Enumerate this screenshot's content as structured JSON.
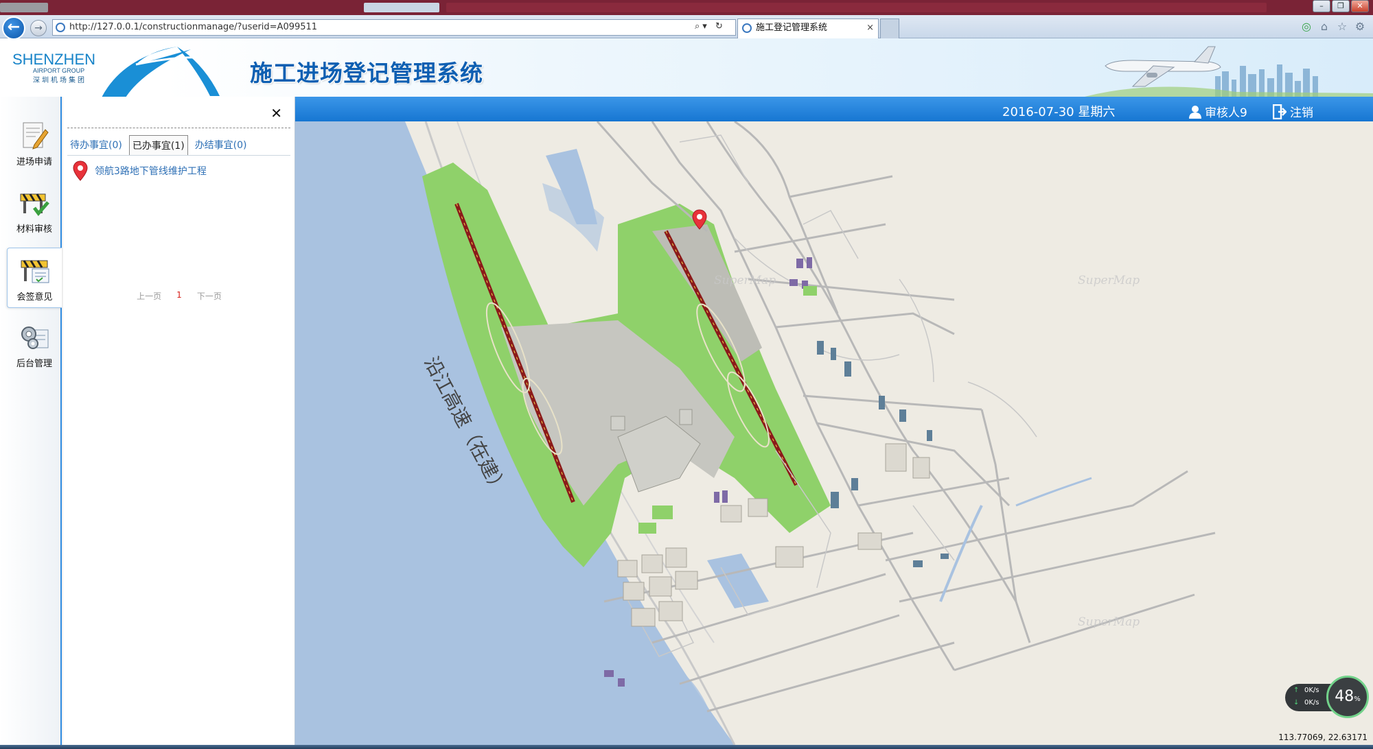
{
  "browser": {
    "url": "http://127.0.0.1/constructionmanage/?userid=A099511",
    "url_tools": "⌕▾ ↻",
    "tab_title": "施工登记管理系统",
    "tab_close": "×"
  },
  "header": {
    "logo_en": "SHENZHEN",
    "logo_sub": "AIRPORT GROUP",
    "logo_cn": "深圳机场集团",
    "title": "施工进场登记管理系统"
  },
  "sidebar": {
    "items": [
      {
        "label": "进场申请",
        "icon": "form-edit-icon"
      },
      {
        "label": "材料审核",
        "icon": "barrier-check-icon"
      },
      {
        "label": "会签意见",
        "icon": "barrier-document-icon"
      },
      {
        "label": "后台管理",
        "icon": "gears-settings-icon"
      }
    ],
    "active_index": 2
  },
  "task_panel": {
    "close_glyph": "✕",
    "tabs": [
      {
        "label": "待办事宜(0)"
      },
      {
        "label": "已办事宜(1)"
      },
      {
        "label": "办结事宜(0)"
      }
    ],
    "active_tab": 1,
    "items": [
      {
        "title": "领航3路地下管线维护工程"
      }
    ],
    "pager": {
      "prev": "上一页",
      "current": "1",
      "next": "下一页"
    }
  },
  "topbar": {
    "date": "2016-07-30 星期六",
    "user": "审核人9",
    "logout": "注销"
  },
  "map": {
    "road_label": "沿江高速（在建）",
    "watermark": "SuperMap",
    "coordinates": "113.77069, 22.63171",
    "net": {
      "up": "0K/s",
      "down": "0K/s",
      "percent": "48",
      "percent_unit": "%"
    },
    "colors": {
      "water": "#a9c2e0",
      "land": "#eeebe3",
      "green": "#8fd16a",
      "runway": "#8b1a1a",
      "road": "#b8b8b8"
    }
  }
}
